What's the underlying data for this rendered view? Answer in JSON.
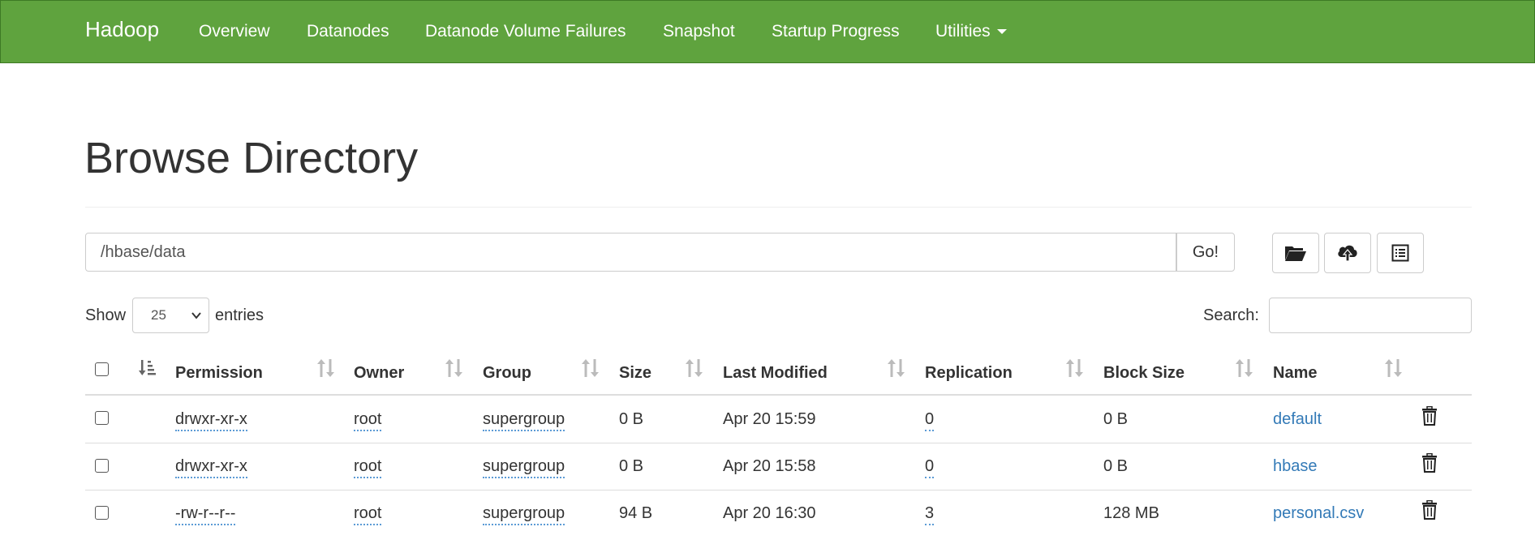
{
  "navbar": {
    "brand": "Hadoop",
    "items": [
      "Overview",
      "Datanodes",
      "Datanode Volume Failures",
      "Snapshot",
      "Startup Progress",
      "Utilities"
    ],
    "color": "#5fa33e"
  },
  "page_title": "Browse Directory",
  "path_bar": {
    "value": "/hbase/data",
    "go_label": "Go!"
  },
  "toolbar_icons": [
    "folder-open-icon",
    "cloud-upload-icon",
    "list-alt-icon"
  ],
  "show": {
    "label": "Show",
    "selected": "25",
    "suffix": "entries"
  },
  "search": {
    "label": "Search:",
    "value": ""
  },
  "table": {
    "columns": [
      "Permission",
      "Owner",
      "Group",
      "Size",
      "Last Modified",
      "Replication",
      "Block Size",
      "Name"
    ],
    "rows": [
      {
        "permission": "drwxr-xr-x",
        "owner": "root",
        "group": "supergroup",
        "size": "0 B",
        "modified": "Apr 20 15:59",
        "replication": "0",
        "block_size": "0 B",
        "name": "default"
      },
      {
        "permission": "drwxr-xr-x",
        "owner": "root",
        "group": "supergroup",
        "size": "0 B",
        "modified": "Apr 20 15:58",
        "replication": "0",
        "block_size": "0 B",
        "name": "hbase"
      },
      {
        "permission": "-rw-r--r--",
        "owner": "root",
        "group": "supergroup",
        "size": "94 B",
        "modified": "Apr 20 16:30",
        "replication": "3",
        "block_size": "128 MB",
        "name": "personal.csv"
      }
    ]
  },
  "colors": {
    "link": "#337ab7",
    "text": "#333333"
  }
}
